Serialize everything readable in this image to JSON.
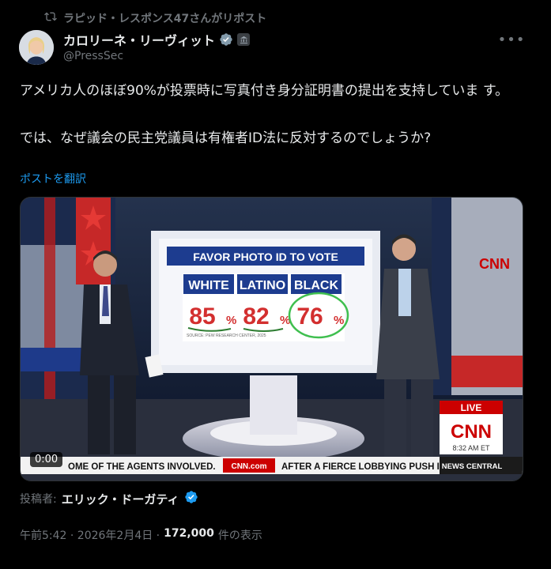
{
  "repost": {
    "text": "ラピッド・レスポンス47さんがリポスト"
  },
  "author": {
    "name": "カロリーネ・リーヴィット",
    "handle": "@PressSec"
  },
  "tweet": {
    "text": "アメリカ人のほぼ90%が投票時に写真付き身分証明書の提出を支持していま す。\n\nでは、なぜ議会の民主党議員は有権者ID法に反対するのでしょうか?",
    "translate_label": "ポストを翻訳"
  },
  "video": {
    "timecode": "0:00",
    "board_title": "FAVOR PHOTO ID TO VOTE",
    "columns": [
      {
        "label": "WHITE",
        "value": "85",
        "unit": "%"
      },
      {
        "label": "LATINO",
        "value": "82",
        "unit": "%"
      },
      {
        "label": "BLACK",
        "value": "76",
        "unit": "%"
      }
    ],
    "source_text": "SOURCE: PEW RESEARCH CENTER, 2025",
    "live_label": "LIVE",
    "network": "CNN",
    "clock": "8:32 AM ET",
    "ticker_left": "OME OF THE AGENTS INVOLVED.",
    "ticker_logo": "CNN.com",
    "ticker_right": "AFTER A FIERCE LOBBYING PUSH I",
    "ticker_tag": "NEWS CENTRAL"
  },
  "credit": {
    "label": "投稿者:",
    "name": "エリック・ドーガティ"
  },
  "meta": {
    "time": "午前5:42 · 2026年2月4日 ·",
    "views": "172,000",
    "views_suffix": "件の表示"
  },
  "colors": {
    "accent": "#1d9bf0",
    "cnn_red": "#cc0000",
    "board_blue": "#1d3c8f"
  }
}
